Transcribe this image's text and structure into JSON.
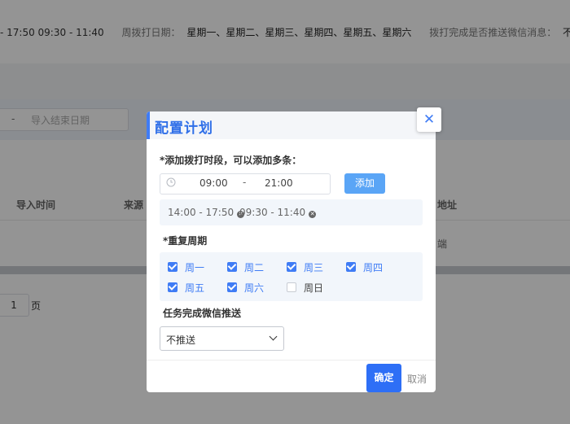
{
  "background": {
    "info": {
      "time_ranges": "- 17:50 09:30 - 11:40",
      "weekday_label": "周拨打日期：",
      "weekday_value": "星期一、星期二、星期三、星期四、星期五、星期六",
      "wechat_label": "拨打完成是否推送微信消息：",
      "wechat_value": "不"
    },
    "filter": {
      "date_separator": "-",
      "end_date_placeholder": "导入结束日期"
    },
    "table": {
      "headers": [
        "导入时间",
        "来源",
        "地址"
      ],
      "cell_fragment": "端"
    },
    "pagination": {
      "page_value": "1",
      "page_unit": "页"
    }
  },
  "dialog": {
    "title": "配置计划",
    "close_icon": "close-icon",
    "add_timeslot_label": "*添加拨打时段，可以添加多条：",
    "time_picker": {
      "start": "09:00",
      "separator": "-",
      "end": "21:00",
      "icon": "clock-icon"
    },
    "add_button": "添加",
    "time_ranges": [
      {
        "text": "14:00 - 17:50"
      },
      {
        "text": "09:30 - 11:40"
      }
    ],
    "repeat_label": "*重复周期",
    "days": [
      {
        "label": "周一",
        "checked": true
      },
      {
        "label": "周二",
        "checked": true
      },
      {
        "label": "周三",
        "checked": true
      },
      {
        "label": "周四",
        "checked": true
      },
      {
        "label": "周五",
        "checked": true
      },
      {
        "label": "周六",
        "checked": true
      },
      {
        "label": "周日",
        "checked": false
      }
    ],
    "wechat_push_label": "任务完成微信推送",
    "wechat_push_value": "不推送",
    "confirm_button": "确定",
    "cancel_button": "取消"
  },
  "colors": {
    "primary": "#2e6ff6",
    "add_button": "#5aa5f6",
    "overlay": "rgba(0,0,0,0.42)"
  }
}
